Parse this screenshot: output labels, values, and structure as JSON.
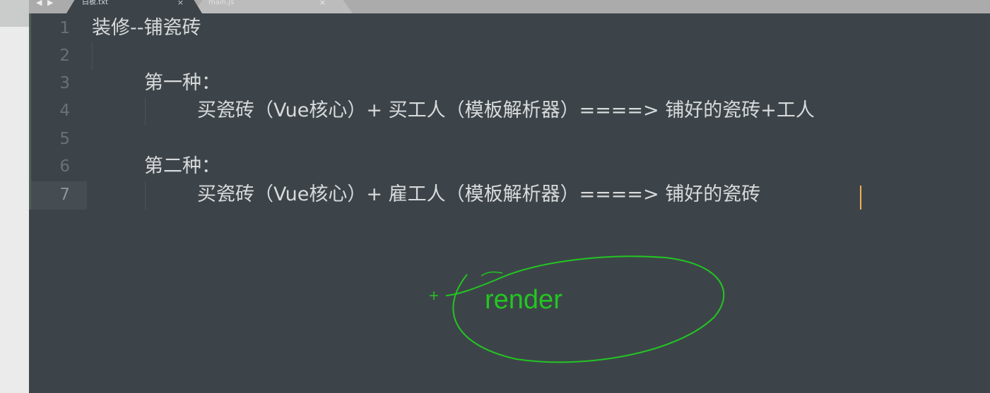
{
  "tabs": [
    {
      "label": "白板.txt",
      "close": "×"
    },
    {
      "label": "main.js",
      "close": "×"
    }
  ],
  "nav": {
    "back": "◀",
    "forward": "▶"
  },
  "editor": {
    "line_numbers": [
      "1",
      "2",
      "3",
      "4",
      "5",
      "6",
      "7"
    ],
    "lines": [
      "装修--铺瓷砖",
      "",
      "第一种：",
      "买瓷砖（Vue核心）+ 买工人（模板解析器）====> 铺好的瓷砖+工人",
      "",
      "第二种：",
      "买瓷砖（Vue核心）+ 雇工人（模板解析器）====> 铺好的瓷砖"
    ],
    "current_line": "7"
  },
  "annotation": {
    "text": "render",
    "color": "#22c622"
  }
}
